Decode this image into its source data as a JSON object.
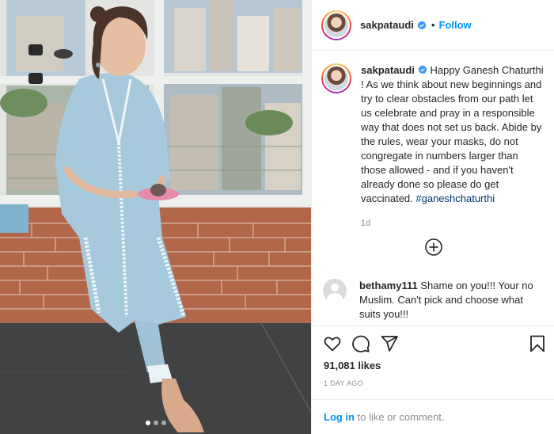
{
  "post": {
    "username": "sakpataudi",
    "separator": "•",
    "follow_label": "Follow",
    "caption": {
      "username": "sakpataudi",
      "text": " Happy Ganesh Chaturthi ! As we think about new beginnings and try to clear obstacles from our path let us celebrate and pray in a responsible way that does not set us back. Abide by the rules, wear your masks, do not congregate in numbers larger than those allowed - and if you haven't already done so please do get vaccinated. ",
      "hashtag": "#ganeshchaturthi",
      "time_ago": "1d"
    },
    "comment": {
      "username": "bethamy111",
      "text": " Shame on you!!! Your no Muslim. Can't pick and choose what suits you!!!"
    },
    "likes": "91,081 likes",
    "date": "1 DAY AGO",
    "login": {
      "link": "Log in",
      "text": " to like or comment."
    },
    "carousel": {
      "count": 3,
      "active_index": 0
    },
    "colors": {
      "accent": "#0095f6",
      "hashtag": "#00376b",
      "muted": "#8e8e8e",
      "text": "#262626",
      "verified": "#3897f0"
    },
    "icons": [
      "heart-icon",
      "comment-icon",
      "share-icon",
      "bookmark-icon",
      "plus-circle-icon",
      "verified-icon"
    ]
  }
}
